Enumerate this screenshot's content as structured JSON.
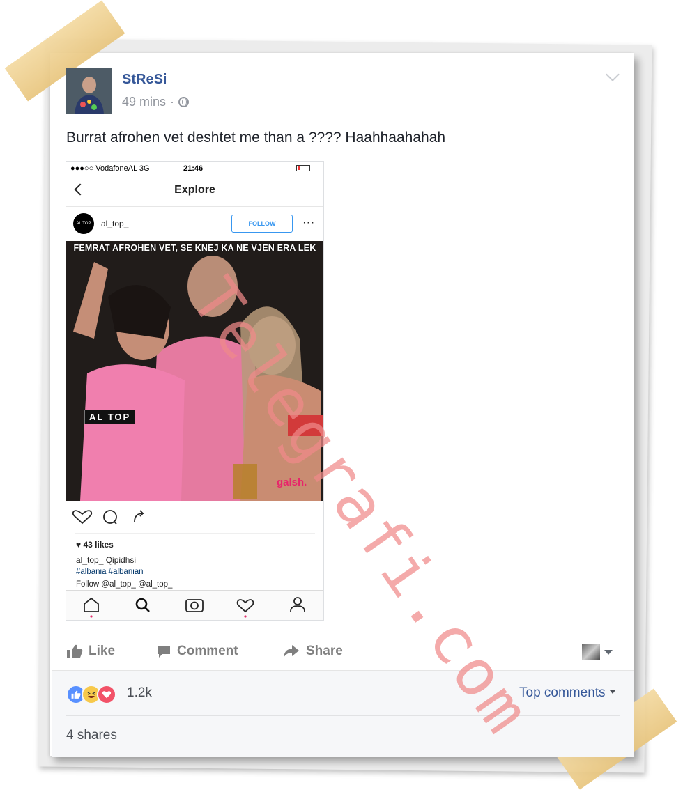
{
  "post": {
    "author": "StReSi",
    "time": "49 mins",
    "separator": "·",
    "text": "Burrat afrohen vet deshtet me than a ???? Haahhaahahah"
  },
  "screenshot": {
    "status": {
      "carrier": "●●●○○ VodafoneAL   3G",
      "time": "21:46"
    },
    "nav_title": "Explore",
    "ig_avatar_text": "AL TOP",
    "username": "al_top_",
    "follow_label": "FOLLOW",
    "more": "···",
    "meme_caption": "FEMRAT AFROHEN VET, SE KNEJ KA NE VJEN ERA LEK",
    "watermark": "AL TOP",
    "photo_credit": "galsh.",
    "likes": "43 likes",
    "caption_line1": "al_top_ Qipidhsi",
    "caption_line2": "#albania #albanian",
    "caption_line3": "Follow @al_top_ @al_top_"
  },
  "actions": {
    "like": "Like",
    "comment": "Comment",
    "share": "Share"
  },
  "reactions": {
    "count": "1.2k",
    "sort_label": "Top comments"
  },
  "shares": "4 shares",
  "overlay_watermark": "Telegrafi.com",
  "colors": {
    "link": "#365899",
    "muted": "#90949c",
    "watermark": "#f08a8a"
  }
}
